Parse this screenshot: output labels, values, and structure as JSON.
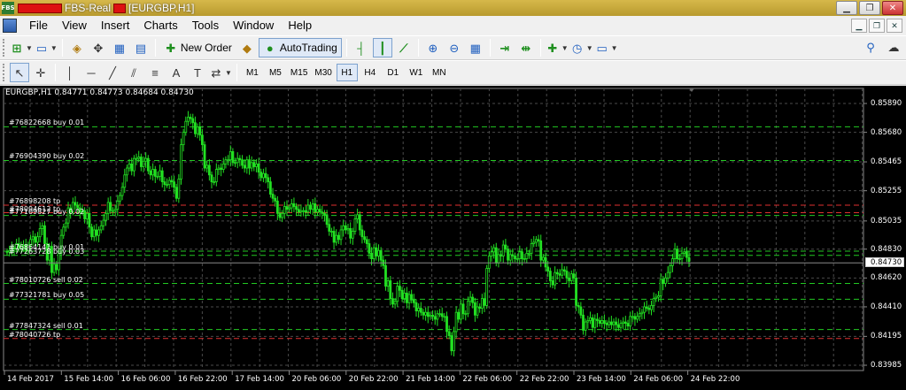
{
  "window": {
    "title": "FBS-Real",
    "chart_title": "[EURGBP,H1]",
    "app_icon": "FBS"
  },
  "menu": [
    "File",
    "View",
    "Insert",
    "Charts",
    "Tools",
    "Window",
    "Help"
  ],
  "toolbar": {
    "new_order": "New Order",
    "autotrading": "AutoTrading"
  },
  "timeframes": [
    "M1",
    "M5",
    "M15",
    "M30",
    "H1",
    "H4",
    "D1",
    "W1",
    "MN"
  ],
  "active_timeframe": "H1",
  "chart": {
    "header": "EURGBP,H1  0.84771 0.84773 0.84684 0.84730",
    "current_price": "0.84730",
    "line_colors": {
      "buy": "#22c922",
      "tp": "#e03030",
      "current": "#888888"
    },
    "candle_color": "#22e022",
    "price_axis": [
      {
        "value": 0.8589,
        "label": "0.85890"
      },
      {
        "value": 0.8568,
        "label": "0.85680"
      },
      {
        "value": 0.85465,
        "label": "0.85465"
      },
      {
        "value": 0.85255,
        "label": "0.85255"
      },
      {
        "value": 0.85035,
        "label": "0.85035"
      },
      {
        "value": 0.8483,
        "label": "0.84830"
      },
      {
        "value": 0.8462,
        "label": "0.84620"
      },
      {
        "value": 0.8441,
        "label": "0.84410"
      },
      {
        "value": 0.84195,
        "label": "0.84195"
      },
      {
        "value": 0.83985,
        "label": "0.83985"
      }
    ],
    "time_axis": [
      "14 Feb 2017",
      "15 Feb 14:00",
      "16 Feb 06:00",
      "16 Feb 22:00",
      "17 Feb 14:00",
      "20 Feb 06:00",
      "20 Feb 22:00",
      "21 Feb 14:00",
      "22 Feb 06:00",
      "22 Feb 22:00",
      "23 Feb 14:00",
      "24 Feb 06:00",
      "24 Feb 22:00"
    ],
    "orders": [
      {
        "label": "#76822668 buy 0.01",
        "price": 0.8572,
        "kind": "buy"
      },
      {
        "label": "#76904390 buy 0.02",
        "price": 0.85475,
        "kind": "buy"
      },
      {
        "label": "#76898208 tp",
        "price": 0.8515,
        "kind": "tp"
      },
      {
        "label": "#78094612 tp",
        "price": 0.85095,
        "kind": "tp"
      },
      {
        "label": "#77109827 buy 0.02",
        "price": 0.85075,
        "kind": "buy"
      },
      {
        "label": "#76864141 buy 0.01",
        "price": 0.84815,
        "kind": "buy"
      },
      {
        "label": "#77263728 buy 0.03",
        "price": 0.84785,
        "kind": "buy"
      },
      {
        "label": "#78010726 sell 0.02",
        "price": 0.8458,
        "kind": "buy"
      },
      {
        "label": "#77321781 buy 0.05",
        "price": 0.84465,
        "kind": "buy"
      },
      {
        "label": "#77847324 sell 0.01",
        "price": 0.84245,
        "kind": "buy"
      },
      {
        "label": "#78040726 tp",
        "price": 0.8418,
        "kind": "tp"
      }
    ],
    "closes": [
      0.8481,
      0.8482,
      0.8484,
      0.8483,
      0.8487,
      0.8484,
      0.8486,
      0.8486,
      0.8482,
      0.8486,
      0.849,
      0.8492,
      0.8488,
      0.8492,
      0.8498,
      0.85,
      0.8487,
      0.8475,
      0.8485,
      0.8466,
      0.8472,
      0.8468,
      0.848,
      0.8493,
      0.8499,
      0.8502,
      0.8513,
      0.851,
      0.8517,
      0.8515,
      0.8513,
      0.851,
      0.8511,
      0.8505,
      0.8509,
      0.8499,
      0.8492,
      0.8497,
      0.8493,
      0.8497,
      0.85,
      0.8504,
      0.8509,
      0.8517,
      0.8511,
      0.8511,
      0.8512,
      0.8518,
      0.8522,
      0.8528,
      0.8537,
      0.8542,
      0.8545,
      0.854,
      0.8549,
      0.8549,
      0.855,
      0.8543,
      0.8547,
      0.8549,
      0.854,
      0.8537,
      0.8541,
      0.8536,
      0.8536,
      0.854,
      0.8532,
      0.853,
      0.853,
      0.8533,
      0.8532,
      0.8528,
      0.852,
      0.8534,
      0.8559,
      0.8568,
      0.8576,
      0.8579,
      0.8578,
      0.8575,
      0.8567,
      0.8572,
      0.8566,
      0.8559,
      0.8542,
      0.8544,
      0.8537,
      0.8532,
      0.8532,
      0.8541,
      0.8542,
      0.8541,
      0.8545,
      0.8548,
      0.8548,
      0.8554,
      0.8546,
      0.8546,
      0.8549,
      0.8548,
      0.8544,
      0.8542,
      0.8548,
      0.8542,
      0.8546,
      0.8543,
      0.8545,
      0.8539,
      0.8535,
      0.8538,
      0.8535,
      0.8532,
      0.8523,
      0.852,
      0.8518,
      0.8509,
      0.8506,
      0.8509,
      0.8514,
      0.8512,
      0.8513,
      0.8516,
      0.8514,
      0.8512,
      0.851,
      0.8511,
      0.8511,
      0.851,
      0.8515,
      0.8512,
      0.8516,
      0.851,
      0.8512,
      0.851,
      0.8509,
      0.8508,
      0.8501,
      0.8496,
      0.8496,
      0.8488,
      0.8493,
      0.849,
      0.8497,
      0.85,
      0.8497,
      0.8498,
      0.8491,
      0.8496,
      0.8505,
      0.8508,
      0.8497,
      0.8492,
      0.849,
      0.8487,
      0.848,
      0.8476,
      0.8484,
      0.8478,
      0.8482,
      0.8475,
      0.8471,
      0.8456,
      0.846,
      0.8447,
      0.8443,
      0.8445,
      0.8456,
      0.8453,
      0.8447,
      0.8451,
      0.8444,
      0.845,
      0.8446,
      0.8444,
      0.8438,
      0.844,
      0.8437,
      0.8435,
      0.8437,
      0.8434,
      0.8435,
      0.8434,
      0.8432,
      0.8436,
      0.8436,
      0.8434,
      0.8434,
      0.8423,
      0.842,
      0.8409,
      0.8423,
      0.8437,
      0.8432,
      0.8443,
      0.8436,
      0.8436,
      0.8445,
      0.8448,
      0.8444,
      0.8435,
      0.8441,
      0.844,
      0.8447,
      0.8442,
      0.8469,
      0.8478,
      0.8481,
      0.8484,
      0.8473,
      0.8479,
      0.8478,
      0.8486,
      0.8483,
      0.8475,
      0.8479,
      0.8478,
      0.8476,
      0.8476,
      0.8481,
      0.8476,
      0.8476,
      0.848,
      0.848,
      0.8487,
      0.8488,
      0.849,
      0.8489,
      0.8475,
      0.8477,
      0.847,
      0.8467,
      0.846,
      0.8457,
      0.8466,
      0.8465,
      0.8464,
      0.8468,
      0.8467,
      0.8462,
      0.846,
      0.8465,
      0.8462,
      0.8442,
      0.8441,
      0.8435,
      0.8424,
      0.843,
      0.8431,
      0.8433,
      0.8426,
      0.8432,
      0.8431,
      0.8429,
      0.8431,
      0.8429,
      0.8428,
      0.843,
      0.8428,
      0.843,
      0.8428,
      0.8426,
      0.8429,
      0.843,
      0.8429,
      0.8427,
      0.8434,
      0.8434,
      0.8432,
      0.8434,
      0.8436,
      0.8437,
      0.8441,
      0.844,
      0.8439,
      0.8442,
      0.8447,
      0.8448,
      0.8449,
      0.8461,
      0.8458,
      0.8462,
      0.8466,
      0.8471,
      0.8476,
      0.8483,
      0.8476,
      0.8476,
      0.848,
      0.8481,
      0.8477,
      0.8474
    ]
  }
}
